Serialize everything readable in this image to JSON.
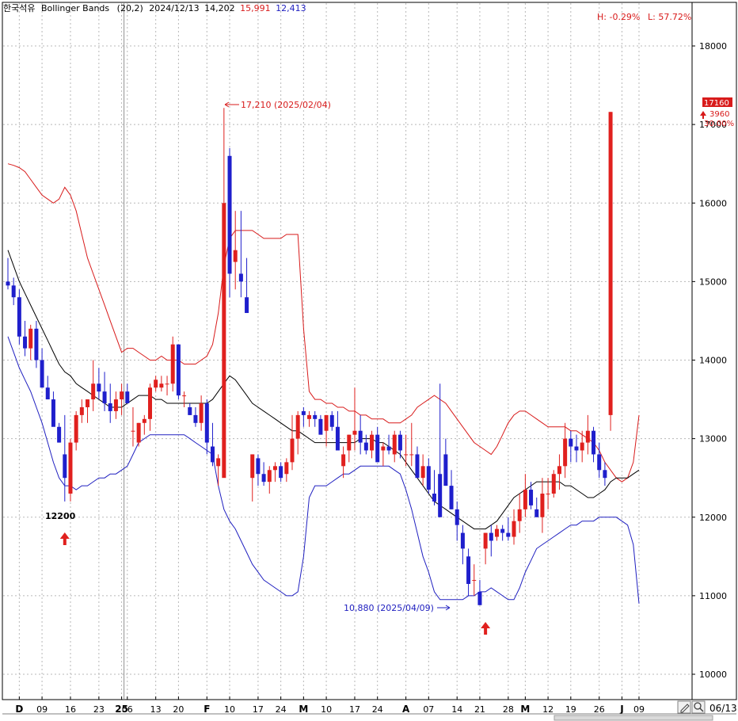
{
  "header": {
    "name": "한국석유",
    "indicator": "Bollinger Bands",
    "params": "(20,2)",
    "date": "2024/12/13",
    "mid_value": "14,202",
    "upper_value": "15,991",
    "lower_value": "12,413",
    "high_pct": "H: -0.29%",
    "low_pct": "L: 57.72%"
  },
  "price_badge": {
    "price": "17160",
    "change": "3960",
    "change_pct": "30.00%",
    "arrow": "up-arrow"
  },
  "annotations": {
    "high": "17,210 (2025/02/04)",
    "low": "10,880 (2025/04/09)",
    "marker": "12200"
  },
  "footer": {
    "date_label": "06/13",
    "zoom_icon": "magnifier-icon",
    "edit_icon": "pencil-icon"
  },
  "colors": {
    "up": "#e0201e",
    "down": "#1f1fcc",
    "upper_band": "#d81b1b",
    "lower_band": "#2020c0",
    "mid_band": "#000000",
    "grid": "#b8b8b8"
  },
  "chart_data": {
    "type": "candlestick",
    "title": "Bollinger Bands (20,2)",
    "ylim": [
      9700,
      18500
    ],
    "yticks": [
      10000,
      11000,
      12000,
      13000,
      14000,
      15000,
      16000,
      17000,
      18000
    ],
    "x_tick_labels": [
      {
        "i": 2,
        "label": "D",
        "bold": true
      },
      {
        "i": 6,
        "label": "09"
      },
      {
        "i": 11,
        "label": "16"
      },
      {
        "i": 16,
        "label": "23"
      },
      {
        "i": 20,
        "label": "25",
        "bold": true
      },
      {
        "i": 21,
        "label": "06"
      },
      {
        "i": 26,
        "label": "13"
      },
      {
        "i": 30,
        "label": "20"
      },
      {
        "i": 35,
        "label": "F",
        "bold": true
      },
      {
        "i": 39,
        "label": "10"
      },
      {
        "i": 44,
        "label": "17"
      },
      {
        "i": 48,
        "label": "24"
      },
      {
        "i": 52,
        "label": "M",
        "bold": true
      },
      {
        "i": 56,
        "label": "10"
      },
      {
        "i": 61,
        "label": "17"
      },
      {
        "i": 65,
        "label": "24"
      },
      {
        "i": 70,
        "label": "A",
        "bold": true
      },
      {
        "i": 74,
        "label": "07"
      },
      {
        "i": 79,
        "label": "14"
      },
      {
        "i": 83,
        "label": "21"
      },
      {
        "i": 88,
        "label": "28"
      },
      {
        "i": 91,
        "label": "M",
        "bold": true
      },
      {
        "i": 95,
        "label": "12"
      },
      {
        "i": 99,
        "label": "19"
      },
      {
        "i": 104,
        "label": "26"
      },
      {
        "i": 108,
        "label": "J",
        "bold": true
      },
      {
        "i": 111,
        "label": "09"
      }
    ],
    "candles": [
      [
        15000,
        15300,
        14900,
        14950
      ],
      [
        14950,
        15050,
        14700,
        14800
      ],
      [
        14800,
        14900,
        14200,
        14300
      ],
      [
        14300,
        14500,
        14050,
        14150
      ],
      [
        14150,
        14450,
        14000,
        14400
      ],
      [
        14400,
        14500,
        13900,
        14000
      ],
      [
        14000,
        14150,
        13700,
        13650
      ],
      [
        13650,
        13800,
        13500,
        13500
      ],
      [
        13500,
        13600,
        13200,
        13150
      ],
      [
        13150,
        13200,
        12950,
        12950
      ],
      [
        12800,
        13300,
        12200,
        12500
      ],
      [
        12300,
        13000,
        12200,
        12950
      ],
      [
        12950,
        13350,
        12850,
        13300
      ],
      [
        13300,
        13500,
        13200,
        13400
      ],
      [
        13400,
        13500,
        13200,
        13500
      ],
      [
        13500,
        14000,
        13350,
        13700
      ],
      [
        13700,
        13900,
        13500,
        13600
      ],
      [
        13600,
        13850,
        13350,
        13450
      ],
      [
        13450,
        13700,
        13200,
        13350
      ],
      [
        13350,
        13600,
        13250,
        13500
      ],
      [
        13500,
        13700,
        13300,
        13600
      ],
      [
        13600,
        13700,
        13450,
        13450
      ],
      [
        13100,
        13400,
        12900,
        13100
      ],
      [
        12950,
        13200,
        12900,
        13200
      ],
      [
        13200,
        13300,
        13050,
        13250
      ],
      [
        13250,
        13700,
        13100,
        13650
      ],
      [
        13650,
        13800,
        13600,
        13750
      ],
      [
        13650,
        13800,
        13600,
        13700
      ],
      [
        13700,
        13800,
        13550,
        13700
      ],
      [
        13700,
        14300,
        13600,
        14200
      ],
      [
        14200,
        14200,
        13500,
        13550
      ],
      [
        13550,
        13600,
        13400,
        13550
      ],
      [
        13400,
        13450,
        13300,
        13300
      ],
      [
        13300,
        13400,
        13150,
        13200
      ],
      [
        13200,
        13550,
        13100,
        13450
      ],
      [
        13450,
        13500,
        12800,
        12950
      ],
      [
        12900,
        13200,
        12650,
        12700
      ],
      [
        12650,
        12800,
        12400,
        12750
      ],
      [
        12500,
        17210,
        13700,
        16000
      ],
      [
        16600,
        16700,
        14800,
        15100
      ],
      [
        15250,
        15900,
        14900,
        15400
      ],
      [
        15100,
        15900,
        14800,
        15000
      ],
      [
        14800,
        15300,
        14600,
        14600
      ],
      [
        12500,
        12800,
        12200,
        12800
      ],
      [
        12750,
        12800,
        12400,
        12550
      ],
      [
        12550,
        12700,
        12400,
        12450
      ],
      [
        12450,
        12650,
        12300,
        12600
      ],
      [
        12600,
        12700,
        12450,
        12650
      ],
      [
        12650,
        12700,
        12450,
        12500
      ],
      [
        12550,
        12750,
        12450,
        12700
      ],
      [
        12700,
        13300,
        12600,
        13000
      ],
      [
        13000,
        13350,
        12800,
        13300
      ],
      [
        13350,
        13400,
        13150,
        13300
      ],
      [
        13250,
        13350,
        13150,
        13300
      ],
      [
        13300,
        13350,
        13150,
        13250
      ],
      [
        13250,
        13300,
        13100,
        13050
      ],
      [
        13100,
        13300,
        12900,
        13300
      ],
      [
        13300,
        13350,
        13100,
        13150
      ],
      [
        13150,
        13350,
        12900,
        12850
      ],
      [
        12650,
        12900,
        12500,
        12800
      ],
      [
        12850,
        13050,
        12700,
        13050
      ],
      [
        13050,
        13650,
        12850,
        13100
      ],
      [
        13100,
        13300,
        12800,
        12950
      ],
      [
        12950,
        13050,
        12800,
        12850
      ],
      [
        12850,
        13100,
        12750,
        13050
      ],
      [
        13050,
        13150,
        12700,
        12700
      ],
      [
        12850,
        12950,
        12650,
        12900
      ],
      [
        12900,
        13050,
        12800,
        12850
      ],
      [
        12800,
        13100,
        12700,
        13050
      ],
      [
        13050,
        13100,
        12750,
        12850
      ],
      [
        12800,
        13050,
        12650,
        12800
      ],
      [
        12800,
        13200,
        12650,
        12800
      ],
      [
        12800,
        12900,
        12500,
        12500
      ],
      [
        12500,
        12800,
        12400,
        12650
      ],
      [
        12650,
        12750,
        12300,
        12350
      ],
      [
        12300,
        12600,
        12150,
        12200
      ],
      [
        12550,
        13700,
        12000,
        12000
      ],
      [
        12800,
        13000,
        12400,
        12400
      ],
      [
        12400,
        12600,
        12100,
        12100
      ],
      [
        12100,
        12200,
        11700,
        11900
      ],
      [
        11800,
        11900,
        11400,
        11600
      ],
      [
        11500,
        11600,
        11000,
        11150
      ],
      [
        11200,
        11400,
        11000,
        11200
      ],
      [
        11050,
        11200,
        10880,
        10880
      ],
      [
        11600,
        11800,
        11400,
        11800
      ],
      [
        11800,
        11900,
        11500,
        11700
      ],
      [
        11750,
        11900,
        11700,
        11850
      ],
      [
        11850,
        11900,
        11700,
        11800
      ],
      [
        11800,
        12000,
        11700,
        11750
      ],
      [
        11750,
        12100,
        11650,
        11950
      ],
      [
        11950,
        12300,
        11800,
        12100
      ],
      [
        12100,
        12550,
        12000,
        12350
      ],
      [
        12350,
        12450,
        12100,
        12150
      ],
      [
        12100,
        12250,
        12000,
        12000
      ],
      [
        12000,
        12500,
        11800,
        12300
      ],
      [
        12300,
        12500,
        12100,
        12300
      ],
      [
        12300,
        12600,
        12250,
        12550
      ],
      [
        12550,
        12800,
        12350,
        12650
      ],
      [
        12650,
        13200,
        12500,
        13000
      ],
      [
        13000,
        13100,
        12700,
        12900
      ],
      [
        12900,
        13050,
        12700,
        12850
      ],
      [
        12850,
        13100,
        12700,
        12950
      ],
      [
        12950,
        13300,
        12800,
        13100
      ],
      [
        13100,
        13150,
        12700,
        12800
      ],
      [
        12800,
        12950,
        12500,
        12600
      ],
      [
        12600,
        12700,
        12400,
        12500
      ]
    ],
    "overlay": {
      "upper": [
        16500,
        16480,
        16450,
        16400,
        16300,
        16200,
        16100,
        16050,
        16000,
        16050,
        16200,
        16100,
        15900,
        15600,
        15300,
        15100,
        14900,
        14700,
        14500,
        14300,
        14100,
        14150,
        14150,
        14100,
        14050,
        14000,
        14000,
        14050,
        14000,
        14000,
        14000,
        13950,
        13950,
        13950,
        14000,
        14050,
        14200,
        14600,
        15200,
        15550,
        15650,
        15650,
        15650,
        15650,
        15600,
        15550,
        15550,
        15550,
        15550,
        15600,
        15600,
        15600,
        14400,
        13600,
        13500,
        13500,
        13450,
        13450,
        13400,
        13400,
        13350,
        13350,
        13300,
        13300,
        13250,
        13250,
        13250,
        13200,
        13200,
        13200,
        13250,
        13300,
        13400,
        13450,
        13500,
        13550,
        13500,
        13450,
        13350,
        13250,
        13150,
        13050,
        12950,
        12900,
        12850,
        12800,
        12900,
        13050,
        13200,
        13300,
        13350,
        13350,
        13300,
        13250,
        13200,
        13150,
        13150,
        13150,
        13150,
        13100,
        13100,
        13050,
        13000,
        12950,
        12850,
        12700,
        12600,
        12500,
        12450,
        12500,
        12700,
        13300
      ],
      "mid": [
        15400,
        15200,
        15000,
        14850,
        14700,
        14550,
        14400,
        14250,
        14100,
        13950,
        13850,
        13800,
        13700,
        13650,
        13600,
        13550,
        13500,
        13450,
        13400,
        13400,
        13400,
        13450,
        13500,
        13550,
        13550,
        13550,
        13500,
        13500,
        13450,
        13450,
        13450,
        13450,
        13450,
        13450,
        13450,
        13450,
        13500,
        13600,
        13700,
        13800,
        13750,
        13650,
        13550,
        13450,
        13400,
        13350,
        13300,
        13250,
        13200,
        13150,
        13100,
        13100,
        13050,
        13000,
        12950,
        12950,
        12950,
        12950,
        12950,
        12950,
        12950,
        12950,
        13000,
        13000,
        13000,
        12950,
        12950,
        12900,
        12850,
        12800,
        12700,
        12600,
        12500,
        12400,
        12300,
        12200,
        12150,
        12100,
        12050,
        12000,
        11950,
        11900,
        11850,
        11850,
        11850,
        11900,
        11950,
        12050,
        12150,
        12250,
        12300,
        12350,
        12400,
        12450,
        12450,
        12450,
        12450,
        12450,
        12400,
        12400,
        12350,
        12300,
        12250,
        12250,
        12300,
        12350,
        12450,
        12500,
        12500,
        12500,
        12550,
        12600
      ],
      "lower": [
        14300,
        14100,
        13900,
        13750,
        13600,
        13400,
        13200,
        12950,
        12700,
        12500,
        12400,
        12400,
        12350,
        12400,
        12400,
        12450,
        12500,
        12500,
        12550,
        12550,
        12600,
        12650,
        12800,
        12950,
        13000,
        13050,
        13050,
        13050,
        13050,
        13050,
        13050,
        13050,
        13000,
        12950,
        12900,
        12850,
        12800,
        12400,
        12100,
        11950,
        11850,
        11700,
        11550,
        11400,
        11300,
        11200,
        11150,
        11100,
        11050,
        11000,
        11000,
        11050,
        11500,
        12250,
        12400,
        12400,
        12400,
        12450,
        12500,
        12550,
        12550,
        12600,
        12650,
        12650,
        12650,
        12650,
        12650,
        12650,
        12600,
        12550,
        12350,
        12100,
        11800,
        11500,
        11300,
        11050,
        10950,
        10950,
        10950,
        10950,
        10950,
        11000,
        11000,
        11050,
        11050,
        11100,
        11050,
        11000,
        10950,
        10950,
        11100,
        11300,
        11450,
        11600,
        11650,
        11700,
        11750,
        11800,
        11850,
        11900,
        11900,
        11950,
        11950,
        11950,
        12000,
        12000,
        12000,
        12000,
        11950,
        11900,
        11650,
        10900
      ]
    },
    "last_candle": [
      13300,
      17160,
      13100,
      17160
    ],
    "markers": [
      {
        "i": 10,
        "type": "buy-arrow"
      },
      {
        "i": 84,
        "type": "buy-arrow"
      }
    ]
  }
}
